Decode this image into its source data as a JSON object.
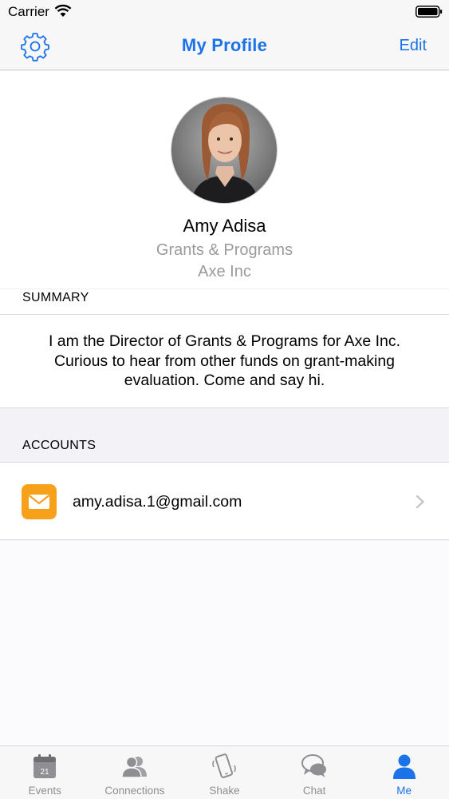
{
  "status_bar": {
    "carrier": "Carrier"
  },
  "nav": {
    "title": "My Profile",
    "edit_label": "Edit"
  },
  "profile": {
    "name": "Amy Adisa",
    "department": "Grants & Programs",
    "company": "Axe Inc"
  },
  "summary": {
    "header": "SUMMARY",
    "text": "I am the Director of Grants & Programs for Axe Inc. Curious to hear from other funds on grant-making evaluation. Come and say hi."
  },
  "accounts": {
    "header": "ACCOUNTS",
    "items": [
      {
        "type": "mail-icon",
        "label": "amy.adisa.1@gmail.com"
      }
    ]
  },
  "tabs": [
    {
      "label": "Events",
      "icon": "calendar-icon",
      "badge": "21",
      "active": false
    },
    {
      "label": "Connections",
      "icon": "people-icon",
      "active": false
    },
    {
      "label": "Shake",
      "icon": "phone-shake-icon",
      "active": false
    },
    {
      "label": "Chat",
      "icon": "chat-bubbles-icon",
      "active": false
    },
    {
      "label": "Me",
      "icon": "person-icon",
      "active": true
    }
  ],
  "colors": {
    "accent": "#1a73e8",
    "mail_icon_bg": "#f7a11a",
    "inactive_tab": "#8e8e93"
  }
}
